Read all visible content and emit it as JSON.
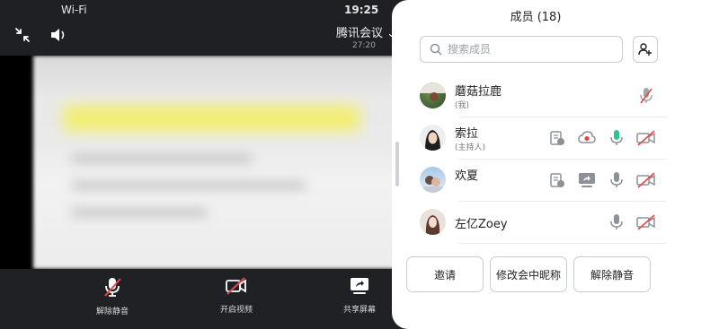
{
  "status_bar": {
    "wifi": "Wi-Fi",
    "time": "19:25"
  },
  "meeting": {
    "title": "腾讯会议 ⌄",
    "duration": "27:20",
    "icons": {
      "minimize": "collapse-arrows-icon",
      "speaker": "speaker-icon"
    }
  },
  "bottom_bar": {
    "items": [
      {
        "label": "解除静音",
        "icon": "microphone-muted-icon"
      },
      {
        "label": "开启视频",
        "icon": "video-off-icon"
      },
      {
        "label": "共享屏幕",
        "icon": "share-screen-icon"
      }
    ]
  },
  "panel": {
    "title": "成员 (18)",
    "search_placeholder": "搜索成员",
    "members": [
      {
        "name": "蘑菇拉鹿",
        "role": "(我)",
        "icons": [
          "microphone-muted-icon"
        ]
      },
      {
        "name": "索拉",
        "role": "(主持人)",
        "icons": [
          "document-icon",
          "cloud-record-icon",
          "microphone-active-icon",
          "video-off-icon"
        ]
      },
      {
        "name": "欢夏",
        "role": "",
        "icons": [
          "document-icon",
          "screen-share-icon",
          "microphone-icon",
          "video-off-icon"
        ]
      },
      {
        "name": "左亿Zoey",
        "role": "",
        "icons": [
          "microphone-icon",
          "video-off-icon"
        ]
      }
    ],
    "buttons": {
      "invite": "邀请",
      "rename": "修改会中昵称",
      "unmute_all": "解除静音"
    }
  },
  "colors": {
    "accent_green": "#2bc48a",
    "muted_red": "#e14b4b",
    "record_red": "#e8423f"
  }
}
